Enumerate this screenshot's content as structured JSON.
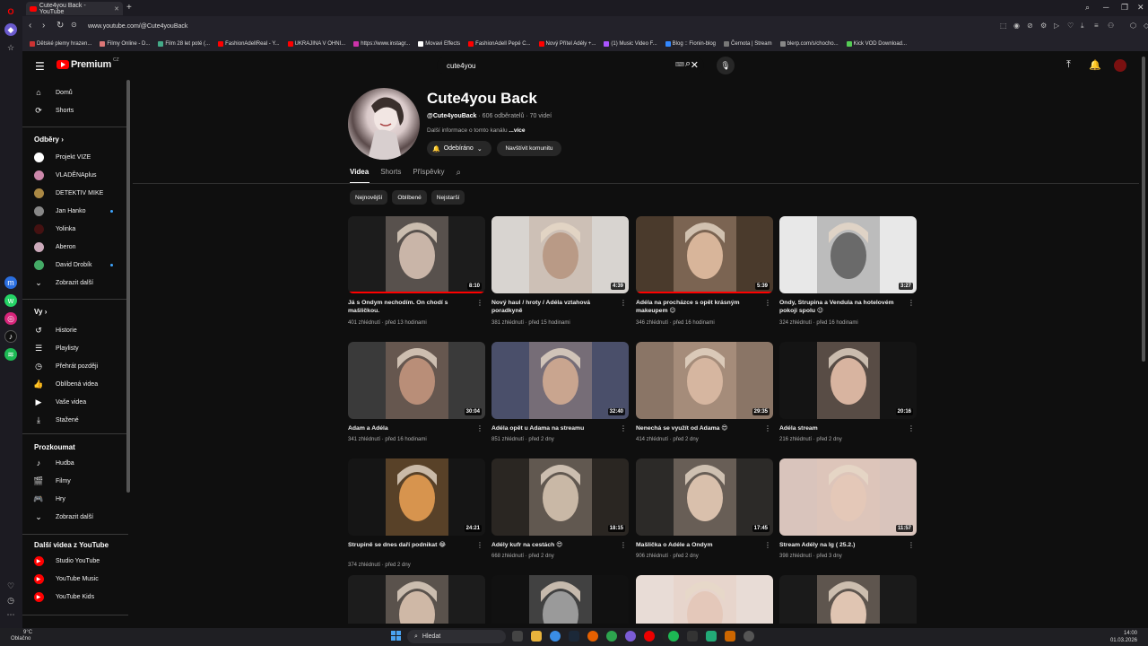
{
  "browser": {
    "tab_title": "Cute4you Back - YouTube",
    "url": "www.youtube.com/@Cute4youBack",
    "bookmarks": [
      {
        "label": "Dětské plemy hrazen...",
        "color": "#c33"
      },
      {
        "label": "Filmy Online - D...",
        "color": "#d77"
      },
      {
        "label": "Film 28 let poté (...",
        "color": "#4a8"
      },
      {
        "label": "FashionAdellReal - Y...",
        "color": "#f00"
      },
      {
        "label": "UKRAJINA V OHNI...",
        "color": "#f00"
      },
      {
        "label": "https://www.instagr...",
        "color": "#c3a"
      },
      {
        "label": "Movavi Effects",
        "color": "#fff"
      },
      {
        "label": "FashionAdell Pepé C...",
        "color": "#f00"
      },
      {
        "label": "Nový Přítel Adély +...",
        "color": "#f00"
      },
      {
        "label": "(1) Music Video F...",
        "color": "#a5f"
      },
      {
        "label": "Blog :: Fionin-blog",
        "color": "#38f"
      },
      {
        "label": "Černota | Stream",
        "color": "#777"
      },
      {
        "label": "blerp.com/s/chocho...",
        "color": "#888"
      },
      {
        "label": "Kick VOD Download...",
        "color": "#5c5"
      }
    ]
  },
  "masthead": {
    "logo_text": "Premium",
    "logo_region": "CZ",
    "search_value": "cute4you"
  },
  "guide": {
    "main": [
      {
        "icon": "home-icon",
        "glyph": "⌂",
        "label": "Domů"
      },
      {
        "icon": "shorts-icon",
        "glyph": "⟳",
        "label": "Shorts"
      }
    ],
    "subs_header": "Odběry",
    "subscriptions": [
      {
        "label": "Projekt VIZE",
        "color": "#fff",
        "dot": false
      },
      {
        "label": "VLADĚNAplus",
        "color": "#c8a",
        "dot": false
      },
      {
        "label": "DETEKTIV MIKE",
        "color": "#a84",
        "dot": false
      },
      {
        "label": "Jan Hanko",
        "color": "#888",
        "dot": true
      },
      {
        "label": "Yolinka",
        "color": "#411",
        "dot": false
      },
      {
        "label": "Aberon",
        "color": "#cab",
        "dot": false
      },
      {
        "label": "David Drobík",
        "color": "#4a6",
        "dot": true
      }
    ],
    "subs_more": "Zobrazit další",
    "you_header": "Vy",
    "you": [
      {
        "icon": "history-icon",
        "glyph": "↺",
        "label": "Historie"
      },
      {
        "icon": "playlists-icon",
        "glyph": "☰",
        "label": "Playlisty"
      },
      {
        "icon": "watch-later-icon",
        "glyph": "◷",
        "label": "Přehrát později"
      },
      {
        "icon": "liked-videos-icon",
        "glyph": "👍",
        "label": "Oblíbená videa"
      },
      {
        "icon": "your-videos-icon",
        "glyph": "▶",
        "label": "Vaše videa"
      },
      {
        "icon": "downloads-icon",
        "glyph": "⤓",
        "label": "Stažené"
      }
    ],
    "explore_header": "Prozkoumat",
    "explore": [
      {
        "icon": "music-icon",
        "glyph": "♪",
        "label": "Hudba"
      },
      {
        "icon": "movies-icon",
        "glyph": "🎬",
        "label": "Filmy"
      },
      {
        "icon": "games-icon",
        "glyph": "🎮",
        "label": "Hry"
      },
      {
        "icon": "chevron-down-icon",
        "glyph": "⌄",
        "label": "Zobrazit další"
      }
    ],
    "more_header": "Další videa z YouTube",
    "more": [
      {
        "label": "Studio YouTube"
      },
      {
        "label": "YouTube Music"
      },
      {
        "label": "YouTube Kids"
      }
    ]
  },
  "channel": {
    "name": "Cute4you Back",
    "handle": "@Cute4youBack",
    "stats": " · 606 odběratelů · 70 videí",
    "desc_prefix": "Další informace o tomto kanálu ",
    "desc_more": "...více",
    "subscribed_label": "Odebíráno",
    "community_label": "Navštívit komunitu",
    "tabs": [
      "Videa",
      "Shorts",
      "Příspěvky"
    ],
    "chips": [
      "Nejnovější",
      "Oblíbené",
      "Nejstarší"
    ]
  },
  "videos": [
    {
      "title": "Já s Ondym nechodím. On chodí s mašličkou.",
      "meta": "401 zhlédnutí · před 13 hodinami",
      "duration": "8:10",
      "bg": "#1c1c1c",
      "face": "#c9b5a8",
      "progress": 100
    },
    {
      "title": "Nový haul / hroty / Adéla vztahová poradkyně",
      "meta": "381 zhlédnutí · před 15 hodinami",
      "duration": "4:39",
      "bg": "#d8d4d0",
      "face": "#b99a86",
      "progress": 0
    },
    {
      "title": "Adéla na procházce s opět krásným makeupem 😉",
      "meta": "346 zhlédnutí · před 16 hodinami",
      "duration": "5:39",
      "bg": "#4a3a2c",
      "face": "#d8b59a",
      "progress": 100
    },
    {
      "title": "Ondy, Strupina a Vendula na hotelovém pokoji spolu 😉",
      "meta": "324 zhlédnutí · před 16 hodinami",
      "duration": "3:27",
      "bg": "#e8e8e8",
      "face": "#6a6a6a",
      "progress": 0
    },
    {
      "title": "Adam a Adéla",
      "meta": "341 zhlédnutí · před 16 hodinami",
      "duration": "30:04",
      "bg": "#3a3a3a",
      "face": "#b98e78",
      "progress": 0
    },
    {
      "title": "Adéla opět u Adama na streamu",
      "meta": "851 zhlédnutí · před 2 dny",
      "duration": "32:40",
      "bg": "#4a4f6a",
      "face": "#c9a58f",
      "progress": 0
    },
    {
      "title": "Nenechá se využít od Adama 😍",
      "meta": "414 zhlédnutí · před 2 dny",
      "duration": "29:35",
      "bg": "#8a7566",
      "face": "#d6b6a0",
      "progress": 0
    },
    {
      "title": "Adéla stream",
      "meta": "216 zhlédnutí · před 2 dny",
      "duration": "20:16",
      "bg": "#141414",
      "face": "#d8b4a0",
      "progress": 0
    },
    {
      "title": "Strupině se dnes daří podnikat 😂",
      "meta": "374 zhlédnutí · před 2 dny",
      "duration": "24:21",
      "bg": "#151515",
      "face": "#d7944e",
      "progress": 0
    },
    {
      "title": "Adély kufr na cestách 😍",
      "meta": "668 zhlédnutí · před 2 dny",
      "duration": "18:15",
      "bg": "#2a2622",
      "face": "#c9b8a6",
      "progress": 0
    },
    {
      "title": "Mašlička o Adéle a Ondym",
      "meta": "906 zhlédnutí · před 2 dny",
      "duration": "17:45",
      "bg": "#2c2a28",
      "face": "#d9c0ac",
      "progress": 0
    },
    {
      "title": "Stream Adély na Ig ( 25.2.)",
      "meta": "398 zhlédnutí · před 3 dny",
      "duration": "11:57",
      "bg": "#d9c4bc",
      "face": "#e4c8b8",
      "progress": 0
    },
    {
      "title": "",
      "meta": "",
      "duration": "",
      "bg": "#1c1c1c",
      "face": "#cfb8a6",
      "progress": 0
    },
    {
      "title": "",
      "meta": "",
      "duration": "",
      "bg": "#111",
      "face": "#9a9a9a",
      "progress": 0
    },
    {
      "title": "",
      "meta": "",
      "duration": "",
      "bg": "#e8dcd6",
      "face": "#e4c8ba",
      "progress": 0
    },
    {
      "title": "",
      "meta": "",
      "duration": "",
      "bg": "#1a1a1a",
      "face": "#e0c5b2",
      "progress": 0
    }
  ],
  "taskbar": {
    "weather_temp": "9°C",
    "weather_text": "Oblačno",
    "search_label": "Hledat",
    "time": "14:00",
    "date": "01.03.2026"
  }
}
